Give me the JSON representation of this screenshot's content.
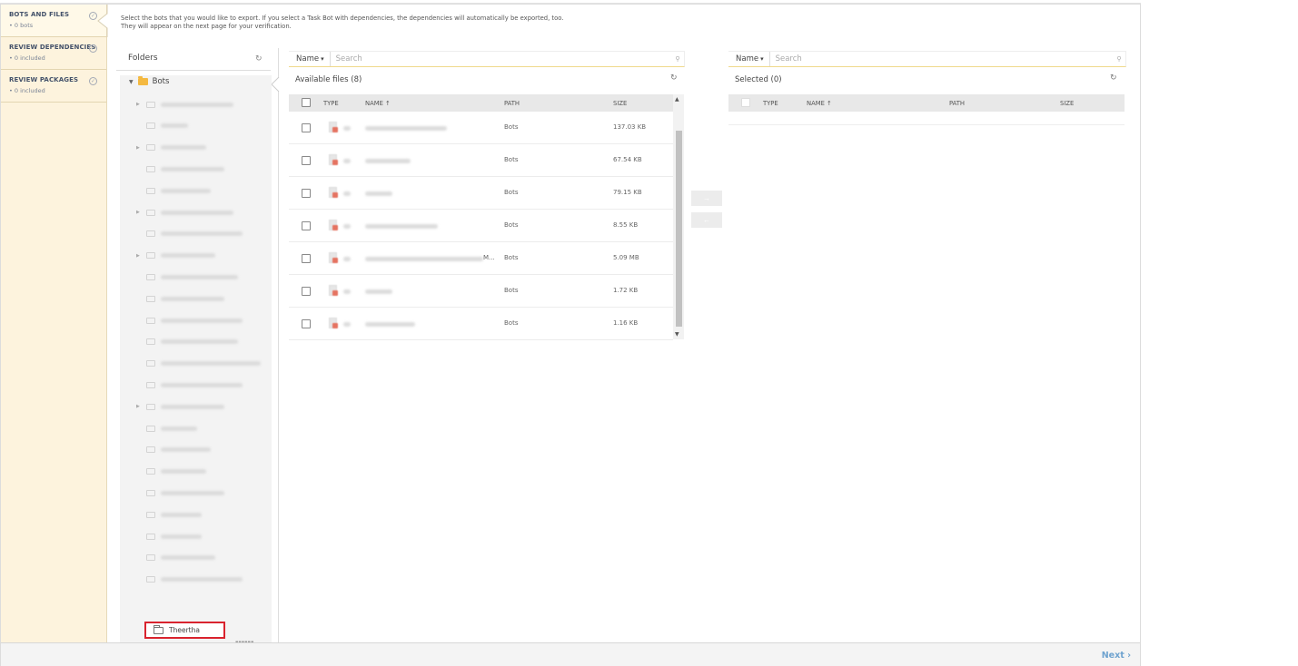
{
  "wizard": {
    "steps": [
      {
        "title": "BOTS AND FILES",
        "subtitle": "• 0 bots",
        "active": true
      },
      {
        "title": "REVIEW DEPENDENCIES",
        "subtitle": "• 0 included"
      },
      {
        "title": "REVIEW PACKAGES",
        "subtitle": "• 0 included"
      }
    ]
  },
  "instructions": {
    "line1": "Select the bots that you would like to export. If you select a Task Bot with dependencies, the dependencies will automatically be exported, too.",
    "line2": "They will appear on the next page for your verification."
  },
  "folders": {
    "title": "Folders",
    "root": "Bots",
    "highlighted": "Theertha"
  },
  "available": {
    "search_field": "Name",
    "search_placeholder": "Search",
    "title": "Available files (8)",
    "columns": [
      "TYPE",
      "NAME ↑",
      "PATH",
      "SIZE"
    ],
    "rows": [
      {
        "path": "Bots",
        "size": "137.03 KB"
      },
      {
        "path": "Bots",
        "size": "67.54 KB"
      },
      {
        "path": "Bots",
        "size": "79.15 KB"
      },
      {
        "path": "Bots",
        "size": "8.55 KB"
      },
      {
        "path": "Bots",
        "size": "5.09 MB",
        "name_tail": "M..."
      },
      {
        "path": "Bots",
        "size": "1.72 KB"
      },
      {
        "path": "Bots",
        "size": "1.16 KB"
      }
    ]
  },
  "selected": {
    "search_field": "Name",
    "search_placeholder": "Search",
    "title": "Selected (0)",
    "columns": [
      "TYPE",
      "NAME ↑",
      "PATH",
      "SIZE"
    ]
  },
  "footer": {
    "next_label": "Next ›"
  },
  "icons": {
    "refresh": "refresh-icon",
    "search": "search-icon",
    "check_circle": "check-circle-icon",
    "folder": "folder-icon"
  }
}
